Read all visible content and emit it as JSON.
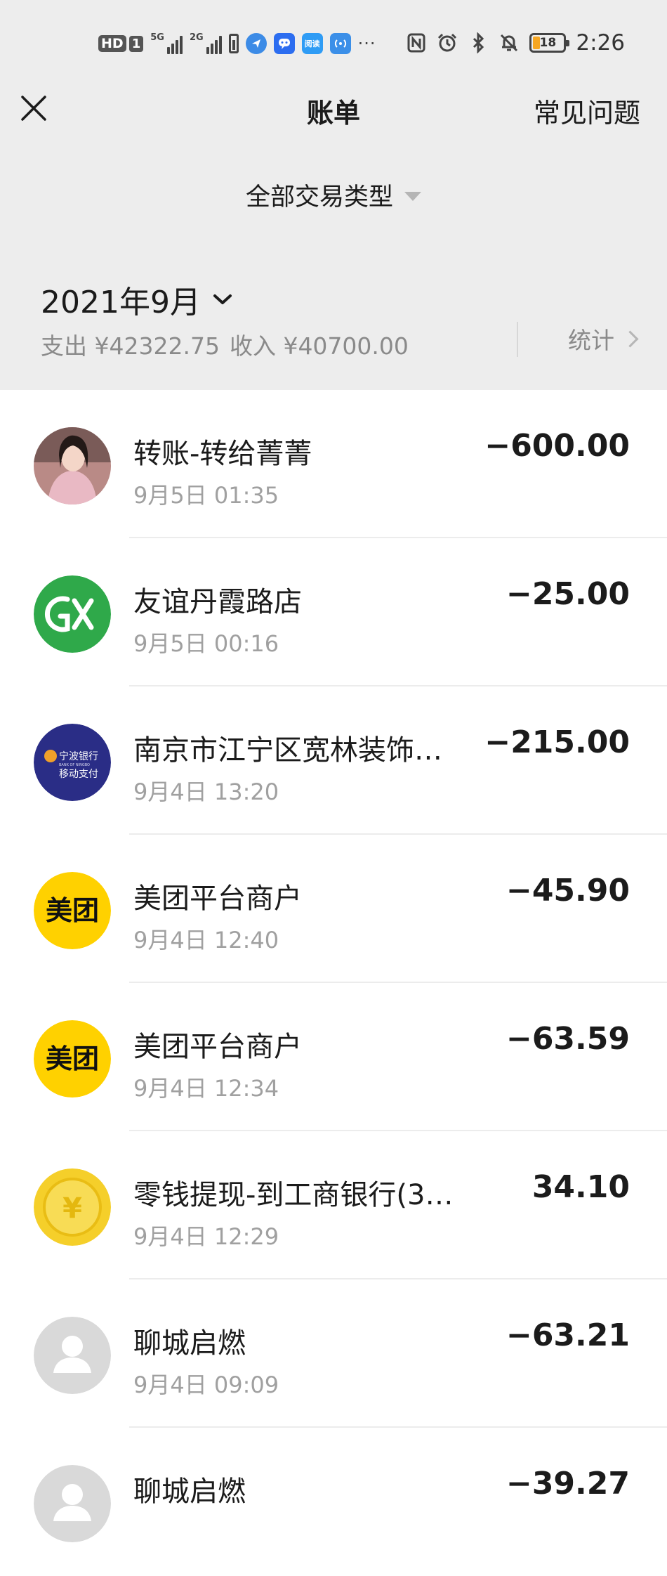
{
  "status_bar": {
    "hd_label": "HD",
    "sim_label": "1",
    "net1_tag": "5G",
    "net2_tag": "2G",
    "app_icons": [
      {
        "icon": "vpn-app-icon",
        "color": "#3c8be6",
        "text": ""
      },
      {
        "icon": "chat-app-icon",
        "color": "#2c6df0",
        "text": ""
      },
      {
        "icon": "reading-app-icon",
        "color": "#2f9cf5",
        "text": "阅读"
      },
      {
        "icon": "wifi-signal-app-icon",
        "color": "#3b8fe8",
        "text": ""
      }
    ],
    "more": "···",
    "battery_level": "18",
    "time": "2:26"
  },
  "nav": {
    "title": "账单",
    "faq": "常见问题"
  },
  "filter": {
    "label": "全部交易类型"
  },
  "month": {
    "label": "2021年9月",
    "expense_label": "支出 ¥42322.75",
    "income_label": "收入 ¥40700.00",
    "stats_label": "统计"
  },
  "transactions": [
    {
      "title": "转账-转给菁菁",
      "time": "9月5日 01:35",
      "amount": "−600.00",
      "avatar": "person-photo"
    },
    {
      "title": "友谊丹霞路店",
      "time": "9月5日 00:16",
      "amount": "−25.00",
      "avatar": "store-logo"
    },
    {
      "title": "南京市江宁区宽林装饰…",
      "time": "9月4日 13:20",
      "amount": "−215.00",
      "avatar": "bank-logo",
      "logo_text_1": "宁波银行",
      "logo_text_2": "BANK OF NINGBO",
      "logo_text_3": "移动支付"
    },
    {
      "title": "美团平台商户",
      "time": "9月4日 12:40",
      "amount": "−45.90",
      "avatar": "meituan-logo",
      "logo_text": "美团"
    },
    {
      "title": "美团平台商户",
      "time": "9月4日 12:34",
      "amount": "−63.59",
      "avatar": "meituan-logo",
      "logo_text": "美团"
    },
    {
      "title": "零钱提现-到工商银行(3…",
      "time": "9月4日 12:29",
      "amount": "34.10",
      "avatar": "coin-icon",
      "logo_text": "¥"
    },
    {
      "title": "聊城启燃",
      "time": "9月4日 09:09",
      "amount": "−63.21",
      "avatar": "default-user"
    },
    {
      "title": "聊城启燃",
      "time": "",
      "amount": "−39.27",
      "avatar": "default-user"
    }
  ]
}
